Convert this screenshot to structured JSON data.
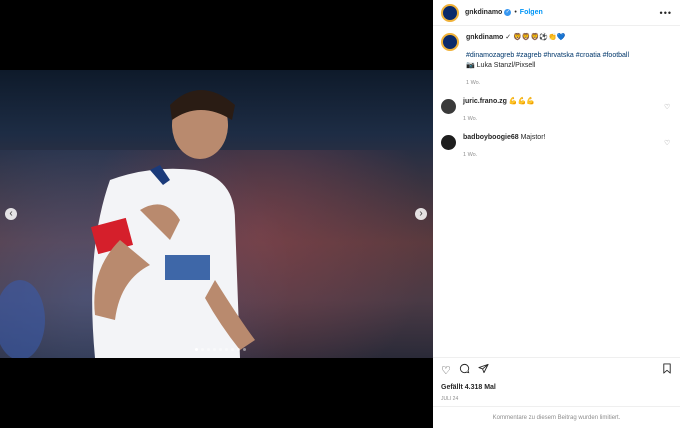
{
  "post": {
    "username": "gnkdinamo",
    "verified_mark": "✓",
    "separator": "•",
    "follow_label": "Folgen",
    "more_label": "•••"
  },
  "caption": {
    "username": "gnkdinamo",
    "emojis": "✓ 🦁🦁🦁⚽👏💙",
    "hashtags": "#dinamozagreb #zagreb #hrvatska #croatia #football",
    "credit": "📷 Luka Stanzl/Pixsell",
    "time": "1 Wo."
  },
  "comments": [
    {
      "username": "juric.frano.zg",
      "text": "💪💪💪",
      "time": "1 Wo."
    },
    {
      "username": "badboyboogie68",
      "text": "Majstor!",
      "time": "1 Wo."
    }
  ],
  "actions": {
    "like_icon": "heart-icon",
    "comment_icon": "comment-icon",
    "share_icon": "share-icon",
    "save_icon": "bookmark-icon",
    "likes_text": "Gefällt 4.318 Mal",
    "date": "JULI 24"
  },
  "footer": {
    "limited_text": "Kommentare zu diesem Beitrag wurden limitiert."
  },
  "carousel": {
    "prev_label": "‹",
    "next_label": "›",
    "slide_count": 9,
    "active_index": 0
  }
}
